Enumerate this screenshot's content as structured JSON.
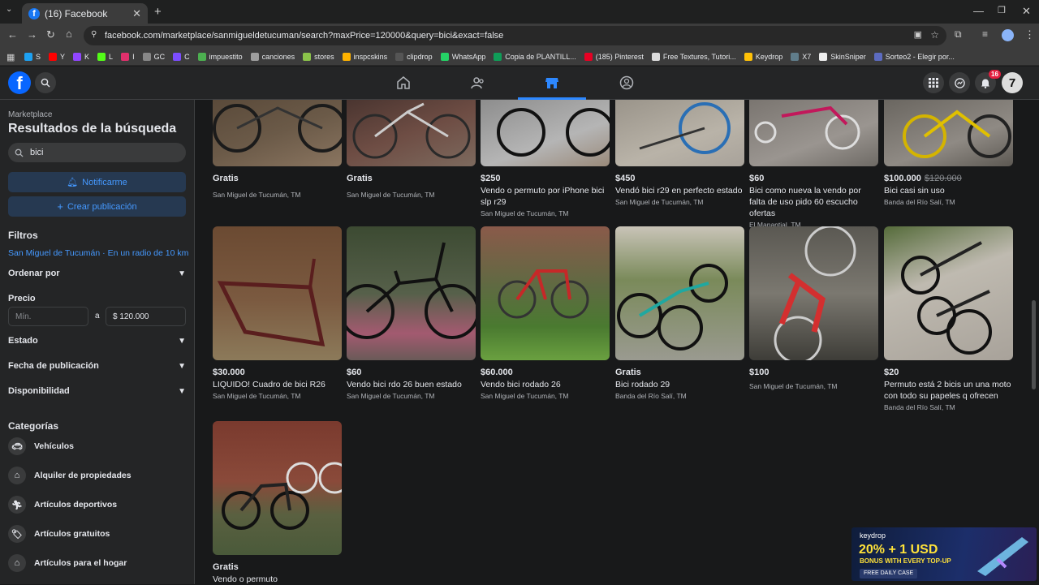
{
  "browser": {
    "tab_title": "(16) Facebook",
    "url": "facebook.com/marketplace/sanmigueldetucuman/search?maxPrice=120000&query=bici&exact=false",
    "bookmarks": [
      "S",
      "Y",
      "K",
      "L",
      "I",
      "GC",
      "C",
      "impuestito",
      "canciones",
      "stores",
      "inspcskins",
      "clipdrop",
      "WhatsApp",
      "Copia de PLANTILL...",
      "(185) Pinterest",
      "Free Textures, Tutori...",
      "Keydrop",
      "X7",
      "SkinSniper",
      "Sorteo2 - Elegir por..."
    ]
  },
  "header": {
    "notification_count": "16",
    "profile_initial": "7"
  },
  "sidebar": {
    "section": "Marketplace",
    "title": "Resultados de la búsqueda",
    "search_value": "bici",
    "notify_label": "Notificarme",
    "create_label": "Crear publicación",
    "filters_label": "Filtros",
    "location_label": "San Miguel de Tucumán · En un radio de 10 km",
    "sort_label": "Ordenar por",
    "price_label": "Precio",
    "price_min_placeholder": "Mín.",
    "price_separator": "a",
    "price_max_value": "$ 120.000",
    "condition_label": "Estado",
    "date_label": "Fecha de publicación",
    "availability_label": "Disponibilidad",
    "categories_label": "Categorías",
    "categories": [
      "Vehículos",
      "Alquiler de propiedades",
      "Artículos deportivos",
      "Artículos gratuitos",
      "Artículos para el hogar"
    ]
  },
  "listings": [
    {
      "price": "Gratis",
      "old_price": "",
      "title": "",
      "location": "San Miguel de Tucumán, TM"
    },
    {
      "price": "Gratis",
      "old_price": "",
      "title": "",
      "location": "San Miguel de Tucumán, TM"
    },
    {
      "price": "$250",
      "old_price": "",
      "title": "Vendo o permuto por iPhone bici slp r29",
      "location": "San Miguel de Tucumán, TM"
    },
    {
      "price": "$450",
      "old_price": "",
      "title": "Vendó bici r29 en perfecto estado",
      "location": "San Miguel de Tucumán, TM"
    },
    {
      "price": "$60",
      "old_price": "",
      "title": "Bici como nueva la vendo por falta de uso pido 60 escucho ofertas",
      "location": "El Manantial, TM"
    },
    {
      "price": "$100.000",
      "old_price": "$120.000",
      "title": "Bici casi sin uso",
      "location": "Banda del Río Salí, TM"
    },
    {
      "price": "$30.000",
      "old_price": "",
      "title": "LIQUIDO! Cuadro de bici R26",
      "location": "San Miguel de Tucumán, TM"
    },
    {
      "price": "$60",
      "old_price": "",
      "title": "Vendo bici rdo 26 buen estado",
      "location": "San Miguel de Tucumán, TM"
    },
    {
      "price": "$60.000",
      "old_price": "",
      "title": "Vendo bici rodado 26",
      "location": "San Miguel de Tucumán, TM"
    },
    {
      "price": "Gratis",
      "old_price": "",
      "title": "Bici rodado 29",
      "location": "Banda del Río Salí, TM"
    },
    {
      "price": "$100",
      "old_price": "",
      "title": "",
      "location": "San Miguel de Tucumán, TM"
    },
    {
      "price": "$20",
      "old_price": "",
      "title": "Permuto está 2 bicis un una moto con todo su papeles q ofrecen",
      "location": "Banda del Río Salí, TM"
    },
    {
      "price": "Gratis",
      "old_price": "",
      "title": "Vendo o permuto",
      "location": ""
    }
  ],
  "ad": {
    "brand": "keydrop",
    "headline": "20% + 1 USD",
    "subline": "BONUS WITH EVERY TOP-UP",
    "cta": "FREE DAILY CASE"
  },
  "colors": {
    "accent": "#2d88ff",
    "background": "#18191a",
    "surface": "#242526"
  }
}
